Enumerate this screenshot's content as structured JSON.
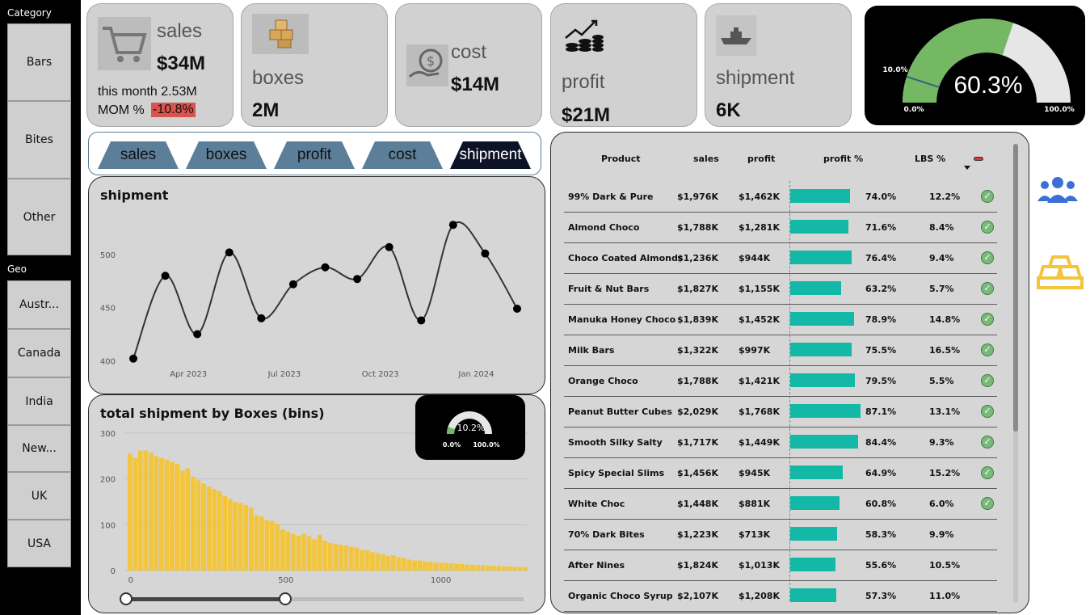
{
  "slicers": {
    "category_title": "Category",
    "category_items": [
      "Bars",
      "Bites",
      "Other"
    ],
    "geo_title": "Geo",
    "geo_items": [
      "Austr...",
      "Canada",
      "India",
      "New...",
      "UK",
      "USA"
    ]
  },
  "kpis": {
    "sales": {
      "label": "sales",
      "value": "$34M",
      "month_line": "this month 2.53M",
      "mom_label": "MOM %",
      "mom_value": "-10.8%"
    },
    "boxes": {
      "label": "boxes",
      "value": "2M"
    },
    "cost": {
      "label": "cost",
      "value": "$14M"
    },
    "profit": {
      "label": "profit",
      "value": "$21M"
    },
    "shipment": {
      "label": "shipment",
      "value": "6K"
    }
  },
  "gauge_main": {
    "value_text": "60.3%",
    "value": 60.3,
    "min_text": "0.0%",
    "max_text": "100.0%",
    "target_text": "10.0%",
    "target": 10.0,
    "fill_color": "#74b863",
    "track_color": "#e6e6e6"
  },
  "tabs": [
    {
      "label": "sales",
      "active": false
    },
    {
      "label": "boxes",
      "active": false
    },
    {
      "label": "profit",
      "active": false
    },
    {
      "label": "cost",
      "active": false
    },
    {
      "label": "shipment",
      "active": true
    }
  ],
  "chart_data": [
    {
      "type": "line",
      "title": "shipment",
      "y_ticks": [
        400,
        450,
        500
      ],
      "ylim": [
        398,
        535
      ],
      "x_tick_labels": [
        "Apr 2023",
        "Jul 2023",
        "Oct 2023",
        "Jan 2024"
      ],
      "series": [
        {
          "values": [
            402,
            480,
            425,
            502,
            440,
            472,
            488,
            477,
            507,
            438,
            528,
            501,
            449
          ]
        }
      ]
    },
    {
      "type": "bar",
      "title": "total shipment by Boxes (bins)",
      "y_ticks": [
        0,
        100,
        200,
        300
      ],
      "ylim": [
        0,
        300
      ],
      "x_ticks": [
        0,
        500,
        1000
      ],
      "xlim": [
        -10,
        1290
      ],
      "bin_width": 17,
      "values": [
        255,
        246,
        262,
        262,
        258,
        250,
        246,
        242,
        237,
        233,
        218,
        223,
        205,
        197,
        190,
        183,
        178,
        173,
        163,
        156,
        150,
        148,
        143,
        138,
        120,
        118,
        110,
        108,
        102,
        90,
        85,
        80,
        76,
        80,
        75,
        68,
        78,
        65,
        60,
        58,
        56,
        55,
        52,
        50,
        45,
        44,
        40,
        38,
        36,
        32,
        33,
        29,
        27,
        24,
        22,
        22,
        20,
        19,
        18,
        17,
        17,
        16,
        15,
        14,
        13,
        12,
        12,
        11,
        11,
        10,
        10,
        9,
        9,
        8,
        8,
        7
      ],
      "color": "#f2c53d"
    }
  ],
  "gauge_small": {
    "value_text": "10.2%",
    "value": 10.2,
    "min_text": "0.0%",
    "max_text": "100.0%"
  },
  "slider": {
    "low": 0,
    "high": 0.4
  },
  "table": {
    "headers": [
      "Product",
      "sales",
      "profit",
      "profit %",
      "LBS %"
    ],
    "bar_color": "#14b8a6",
    "rows": [
      {
        "product": "99% Dark & Pure",
        "sales": "$1,976K",
        "profit": "$1,462K",
        "pct": "74.0%",
        "pct_val": 74.0,
        "lbs": "12.2%",
        "check": true
      },
      {
        "product": "Almond Choco",
        "sales": "$1,788K",
        "profit": "$1,281K",
        "pct": "71.6%",
        "pct_val": 71.6,
        "lbs": "8.4%",
        "check": true
      },
      {
        "product": "Choco Coated Almonds",
        "sales": "$1,236K",
        "profit": "$944K",
        "pct": "76.4%",
        "pct_val": 76.4,
        "lbs": "9.4%",
        "check": true
      },
      {
        "product": "Fruit & Nut Bars",
        "sales": "$1,827K",
        "profit": "$1,155K",
        "pct": "63.2%",
        "pct_val": 63.2,
        "lbs": "5.7%",
        "check": true
      },
      {
        "product": "Manuka Honey Choco",
        "sales": "$1,839K",
        "profit": "$1,452K",
        "pct": "78.9%",
        "pct_val": 78.9,
        "lbs": "14.8%",
        "check": true
      },
      {
        "product": "Milk Bars",
        "sales": "$1,322K",
        "profit": "$997K",
        "pct": "75.5%",
        "pct_val": 75.5,
        "lbs": "16.5%",
        "check": true
      },
      {
        "product": "Orange Choco",
        "sales": "$1,788K",
        "profit": "$1,421K",
        "pct": "79.5%",
        "pct_val": 79.5,
        "lbs": "5.5%",
        "check": true
      },
      {
        "product": "Peanut Butter Cubes",
        "sales": "$2,029K",
        "profit": "$1,768K",
        "pct": "87.1%",
        "pct_val": 87.1,
        "lbs": "13.1%",
        "check": true
      },
      {
        "product": "Smooth Silky Salty",
        "sales": "$1,717K",
        "profit": "$1,449K",
        "pct": "84.4%",
        "pct_val": 84.4,
        "lbs": "9.3%",
        "check": true
      },
      {
        "product": "Spicy Special Slims",
        "sales": "$1,456K",
        "profit": "$945K",
        "pct": "64.9%",
        "pct_val": 64.9,
        "lbs": "15.2%",
        "check": true
      },
      {
        "product": "White Choc",
        "sales": "$1,448K",
        "profit": "$881K",
        "pct": "60.8%",
        "pct_val": 60.8,
        "lbs": "6.0%",
        "check": true
      },
      {
        "product": "70% Dark Bites",
        "sales": "$1,223K",
        "profit": "$713K",
        "pct": "58.3%",
        "pct_val": 58.3,
        "lbs": "9.9%",
        "check": false
      },
      {
        "product": "After Nines",
        "sales": "$1,824K",
        "profit": "$1,013K",
        "pct": "55.6%",
        "pct_val": 55.6,
        "lbs": "10.5%",
        "check": false
      },
      {
        "product": "Organic Choco Syrup",
        "sales": "$2,107K",
        "profit": "$1,208K",
        "pct": "57.3%",
        "pct_val": 57.3,
        "lbs": "11.0%",
        "check": false
      }
    ]
  },
  "side_icons": [
    "users-icon",
    "gold-bars-icon"
  ]
}
